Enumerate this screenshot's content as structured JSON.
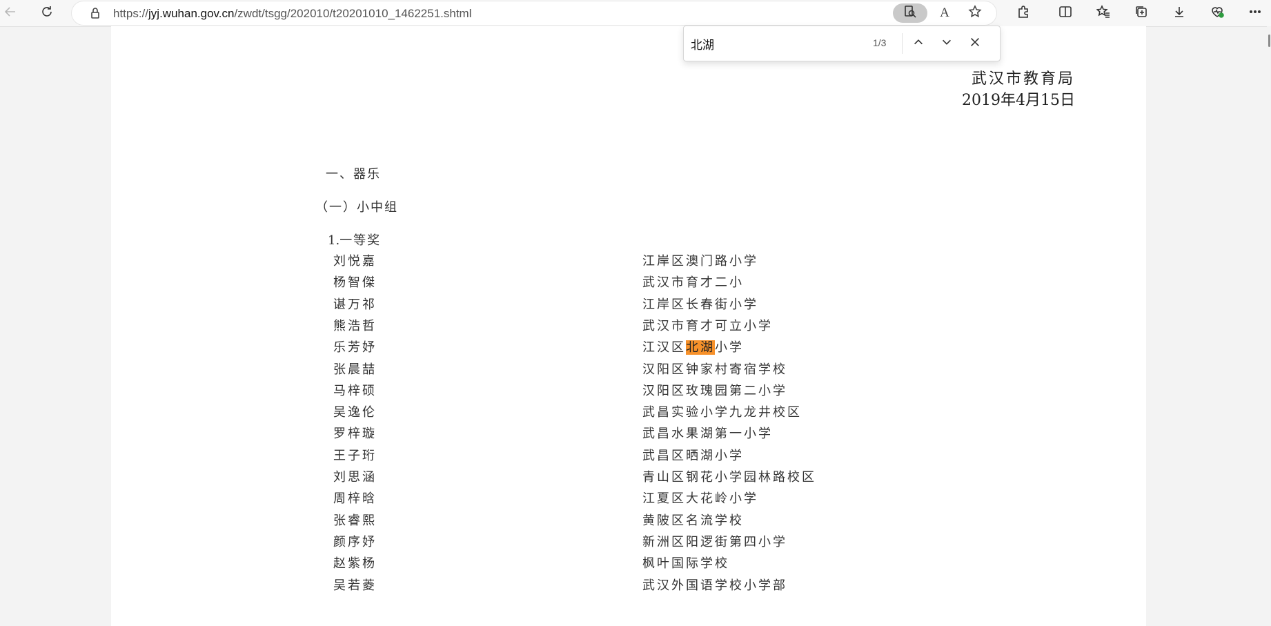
{
  "browser": {
    "url_prefix": "https://",
    "url_host": "jyj.wuhan.gov.cn",
    "url_path": "/zwdt/tsgg/202010/t20201010_1462251.shtml",
    "read_aloud_label": "A",
    "toolbar_icons": [
      "back-icon",
      "refresh-icon",
      "lock-icon",
      "find-icon",
      "read-aloud-icon",
      "favorite-star-icon",
      "extensions-icon",
      "split-screen-icon",
      "favorites-icon",
      "collections-icon",
      "download-icon",
      "browser-essentials-icon",
      "more-icon"
    ]
  },
  "find_bar": {
    "query": "北湖",
    "count": "1/3"
  },
  "document": {
    "signature_org": "武汉市教育局",
    "signature_date": "2019年4月15日",
    "section": "一、器乐",
    "subgroup": "（一）小中组",
    "award_num": "1.",
    "award_text": "一等奖",
    "rows": [
      {
        "name": "刘悦嘉",
        "school": "江岸区澳门路小学"
      },
      {
        "name": "杨智傑",
        "school": "武汉市育才二小"
      },
      {
        "name": "谌万祁",
        "school": "江岸区长春街小学"
      },
      {
        "name": "熊浩哲",
        "school": "武汉市育才可立小学"
      },
      {
        "name": "乐芳妤",
        "school_pre": "江汉区",
        "school_hl": "北湖",
        "school_post": "小学"
      },
      {
        "name": "张晨喆",
        "school": "汉阳区钟家村寄宿学校"
      },
      {
        "name": "马梓硕",
        "school": "汉阳区玫瑰园第二小学"
      },
      {
        "name": "吴逸伦",
        "school": "武昌实验小学九龙井校区"
      },
      {
        "name": "罗梓璇",
        "school": "武昌水果湖第一小学"
      },
      {
        "name": "王子珩",
        "school": "武昌区晒湖小学"
      },
      {
        "name": "刘思涵",
        "school": "青山区钢花小学园林路校区"
      },
      {
        "name": "周梓晗",
        "school": "江夏区大花岭小学"
      },
      {
        "name": "张睿熙",
        "school": "黄陂区名流学校"
      },
      {
        "name": "颜序妤",
        "school": "新洲区阳逻街第四小学"
      },
      {
        "name": "赵紫杨",
        "school": "枫叶国际学校"
      },
      {
        "name": "吴若菱",
        "school": "武汉外国语学校小学部"
      }
    ]
  }
}
